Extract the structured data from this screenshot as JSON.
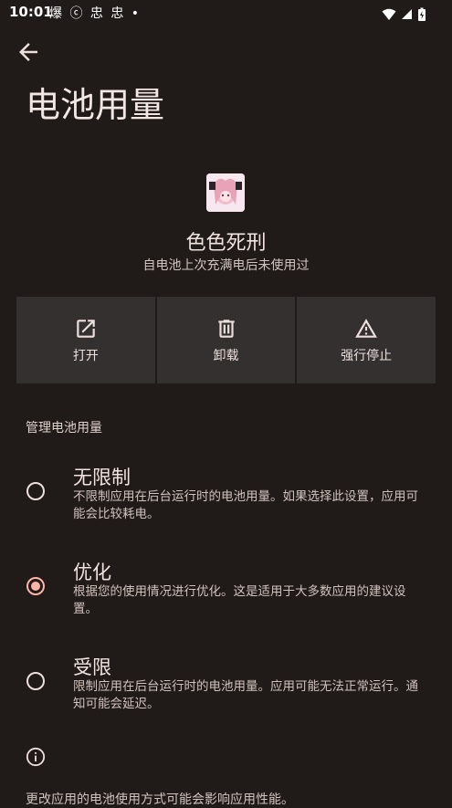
{
  "status_bar": {
    "time": "10:01",
    "notifications": "爆 ⓒ 忠 忠 •"
  },
  "page": {
    "title": "电池用量"
  },
  "app": {
    "name": "色色死刑",
    "usage_summary": "自电池上次充满电后未使用过"
  },
  "actions": [
    {
      "label": "打开",
      "icon": "open-external-icon"
    },
    {
      "label": "卸载",
      "icon": "trash-icon"
    },
    {
      "label": "强行停止",
      "icon": "warning-icon"
    }
  ],
  "battery": {
    "section_title": "管理电池用量",
    "selected": "优化",
    "options": [
      {
        "title": "无限制",
        "description": "不限制应用在后台运行时的电池用量。如果选择此设置，应用可能会比较耗电。"
      },
      {
        "title": "优化",
        "description": "根据您的使用情况进行优化。这是适用于大多数应用的建议设置。"
      },
      {
        "title": "受限",
        "description": "限制应用在后台运行时的电池用量。应用可能无法正常运行。通知可能会延迟。"
      }
    ]
  },
  "footer": {
    "note": "更改应用的电池使用方式可能会影响应用性能。"
  },
  "colors": {
    "background": "#201a18",
    "button_bg": "#353030",
    "text": "#ede0dc",
    "radio_accent": "#ffb4a8"
  }
}
